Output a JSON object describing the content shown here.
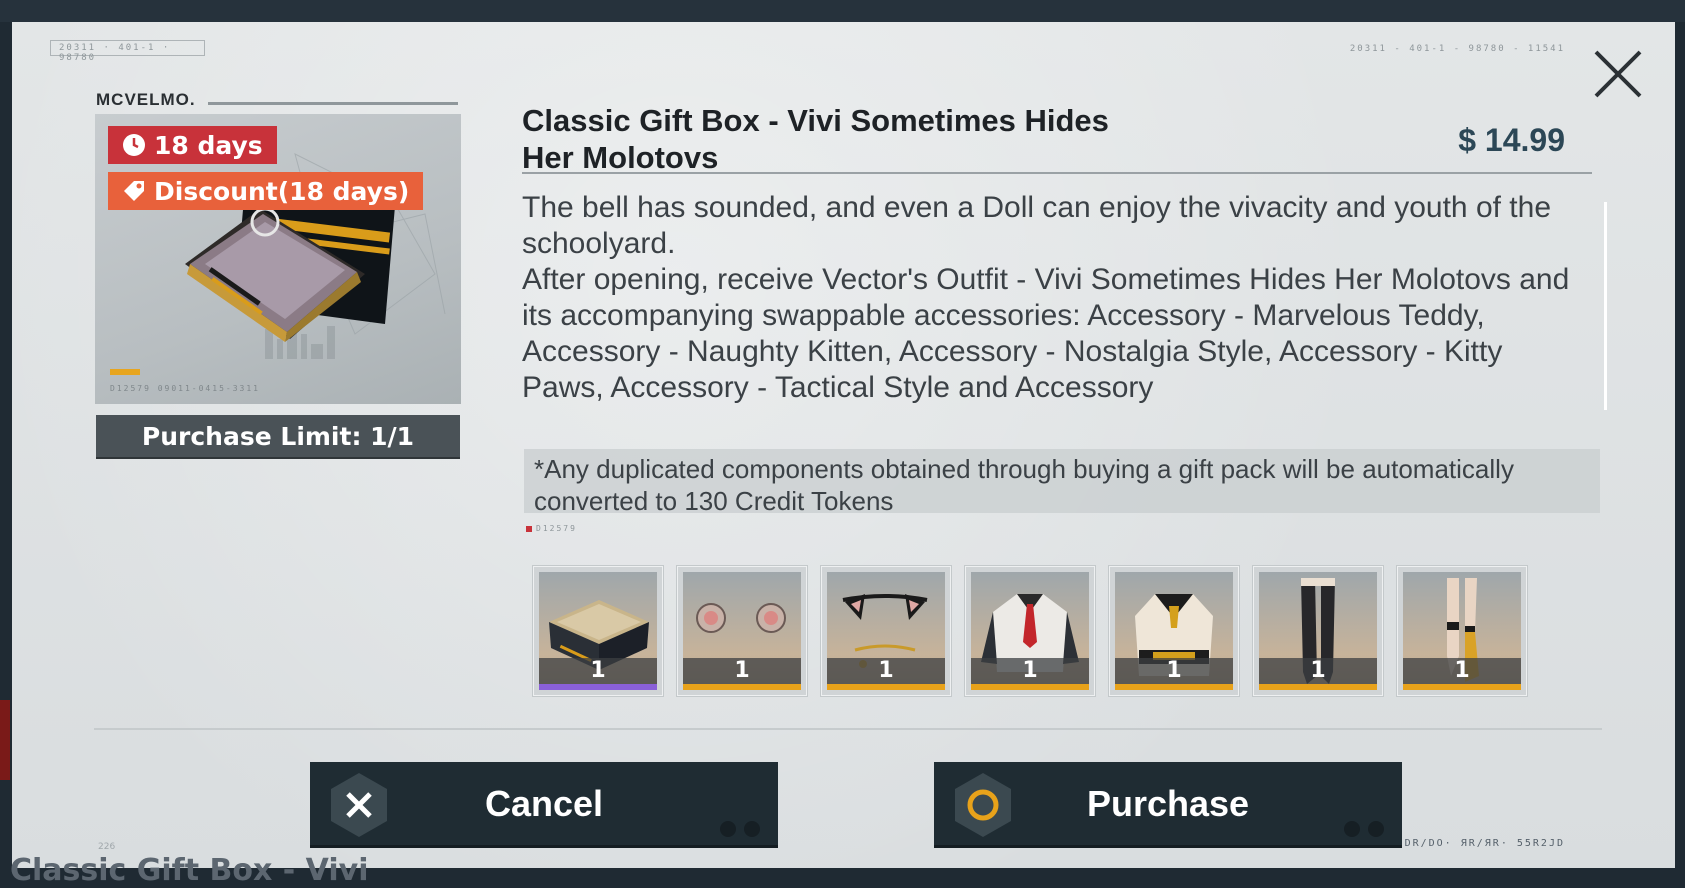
{
  "background": {
    "title_text": "Classic Gift Box - Vivi"
  },
  "header": {
    "code_left": "20311 · 401-1 · 98780",
    "code_right": "20311 - 401-1 - 98780 - 11541"
  },
  "product": {
    "brand": "MCVELMO.",
    "badges": {
      "days": "18 days",
      "discount": "Discount(18 days)"
    },
    "art_code": "D12579 09011-0415-3311",
    "purchase_limit": "Purchase Limit: 1/1",
    "title": "Classic Gift Box - Vivi Sometimes Hides Her Molotovs",
    "price": "$ 14.99",
    "description_1": "The bell has sounded, and even a Doll can enjoy the vivacity and youth of the schoolyard.",
    "description_2": "After opening, receive Vector's Outfit - Vivi Sometimes Hides Her Molotovs and its accompanying swappable accessories: Accessory - Marvelous Teddy, Accessory - Naughty Kitten, Accessory - Nostalgia Style, Accessory - Kitty Paws, Accessory - Tactical Style and Accessory",
    "note": "*Any duplicated components obtained through buying a gift pack will be automatically converted to 130 Credit Tokens"
  },
  "items_code": "D12579",
  "items": [
    {
      "icon": "gift-box-icon",
      "qty": "1",
      "rarity_color": "#8a60d8"
    },
    {
      "icon": "bear-ears-icon",
      "qty": "1",
      "rarity_color": "#e8a21a"
    },
    {
      "icon": "cat-ears-icon",
      "qty": "1",
      "rarity_color": "#e8a21a"
    },
    {
      "icon": "uniform-top-icon",
      "qty": "1",
      "rarity_color": "#e8a21a"
    },
    {
      "icon": "tactical-top-icon",
      "qty": "1",
      "rarity_color": "#e8a21a"
    },
    {
      "icon": "stockings-icon",
      "qty": "1",
      "rarity_color": "#e8a21a"
    },
    {
      "icon": "socks-icon",
      "qty": "1",
      "rarity_color": "#e8a21a"
    }
  ],
  "buttons": {
    "cancel": "Cancel",
    "purchase": "Purchase"
  },
  "footer": {
    "code_left": "226",
    "code_right": "DR/DO· ЯR/ЯR· 55R2JD"
  },
  "colors": {
    "accent_red": "#c8323a",
    "accent_orange": "#e8613b",
    "rarity_gold": "#e8a21a",
    "rarity_purple": "#8a60d8",
    "button_dark": "#1f2c33",
    "price_blue": "#2c4756"
  }
}
